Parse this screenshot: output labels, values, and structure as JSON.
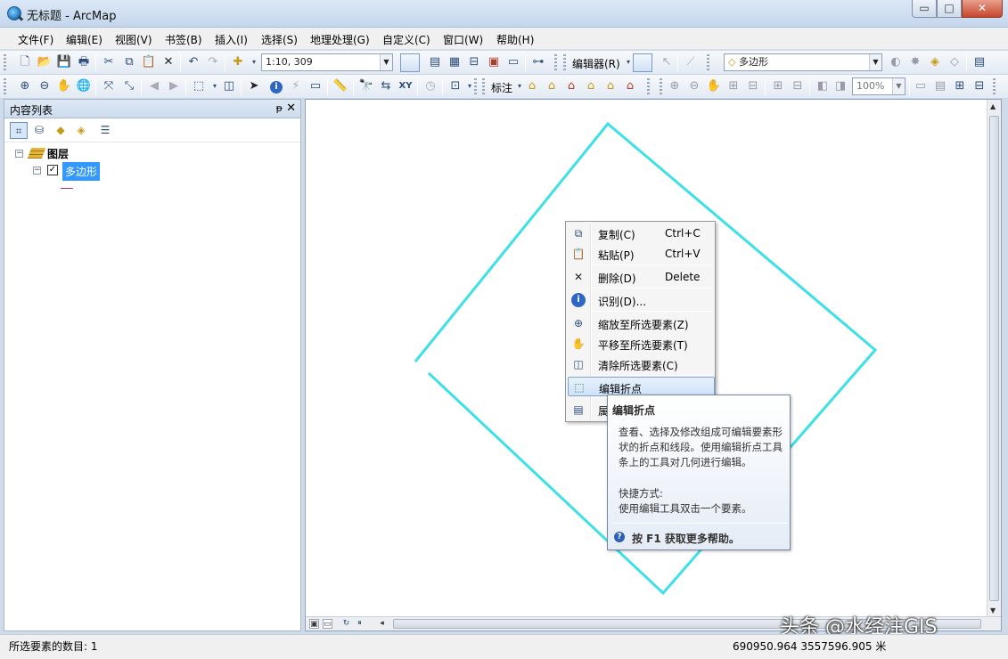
{
  "window": {
    "title": "无标题 - ArcMap",
    "buttons": [
      "▭",
      "□",
      "✕"
    ]
  },
  "menu": [
    "文件(F)",
    "编辑(E)",
    "视图(V)",
    "书签(B)",
    "插入(I)",
    "选择(S)",
    "地理处理(G)",
    "自定义(C)",
    "窗口(W)",
    "帮助(H)"
  ],
  "toolbar1": {
    "scale": "1:10, 309",
    "editor_label": "编辑器(R)",
    "template_value": "多边形"
  },
  "toolbar2": {
    "label_menu": "标注",
    "zoom_value": "100%"
  },
  "toc": {
    "title": "内容列表",
    "pin": "ₚ",
    "close": "✕",
    "layers_label": "图层",
    "layer_name": "多边形",
    "expand_minus": "−",
    "check": "✓"
  },
  "context_menu": {
    "items": [
      {
        "label": "复制(C)",
        "shortcut": "Ctrl+C",
        "icon": "copy-icon"
      },
      {
        "label": "粘贴(P)",
        "shortcut": "Ctrl+V",
        "icon": "paste-icon"
      },
      {
        "label": "删除(D)",
        "shortcut": "Delete",
        "icon": "delete-icon"
      },
      {
        "label": "识别(D)...",
        "shortcut": "",
        "icon": "identify-icon"
      },
      {
        "label": "缩放至所选要素(Z)",
        "shortcut": "",
        "icon": "zoom-to-selected-icon"
      },
      {
        "label": "平移至所选要素(T)",
        "shortcut": "",
        "icon": "pan-to-selected-icon"
      },
      {
        "label": "清除所选要素(C)",
        "shortcut": "",
        "icon": "clear-selection-icon"
      },
      {
        "label": "编辑折点",
        "shortcut": "",
        "icon": "edit-vertices-icon"
      },
      {
        "label": "属",
        "shortcut": "",
        "icon": "attributes-icon"
      }
    ]
  },
  "tooltip": {
    "title": "编辑折点",
    "body": "查看、选择及修改组成可编辑要素形状的折点和线段。使用编辑折点工具条上的工具对几何进行编辑。",
    "shortcut_title": "快捷方式:",
    "shortcut_text": "使用编辑工具双击一个要素。",
    "help": "按 F1 获取更多帮助。"
  },
  "status": {
    "selected_count": "所选要素的数目: 1",
    "coords": "690950.964  3557596.905 米"
  },
  "watermark": "头条 @水经注GIS",
  "colors": {
    "polygon_outline": "#3ee0e8",
    "selection": "#3399ff",
    "tooltip_border": "#7689a3"
  }
}
